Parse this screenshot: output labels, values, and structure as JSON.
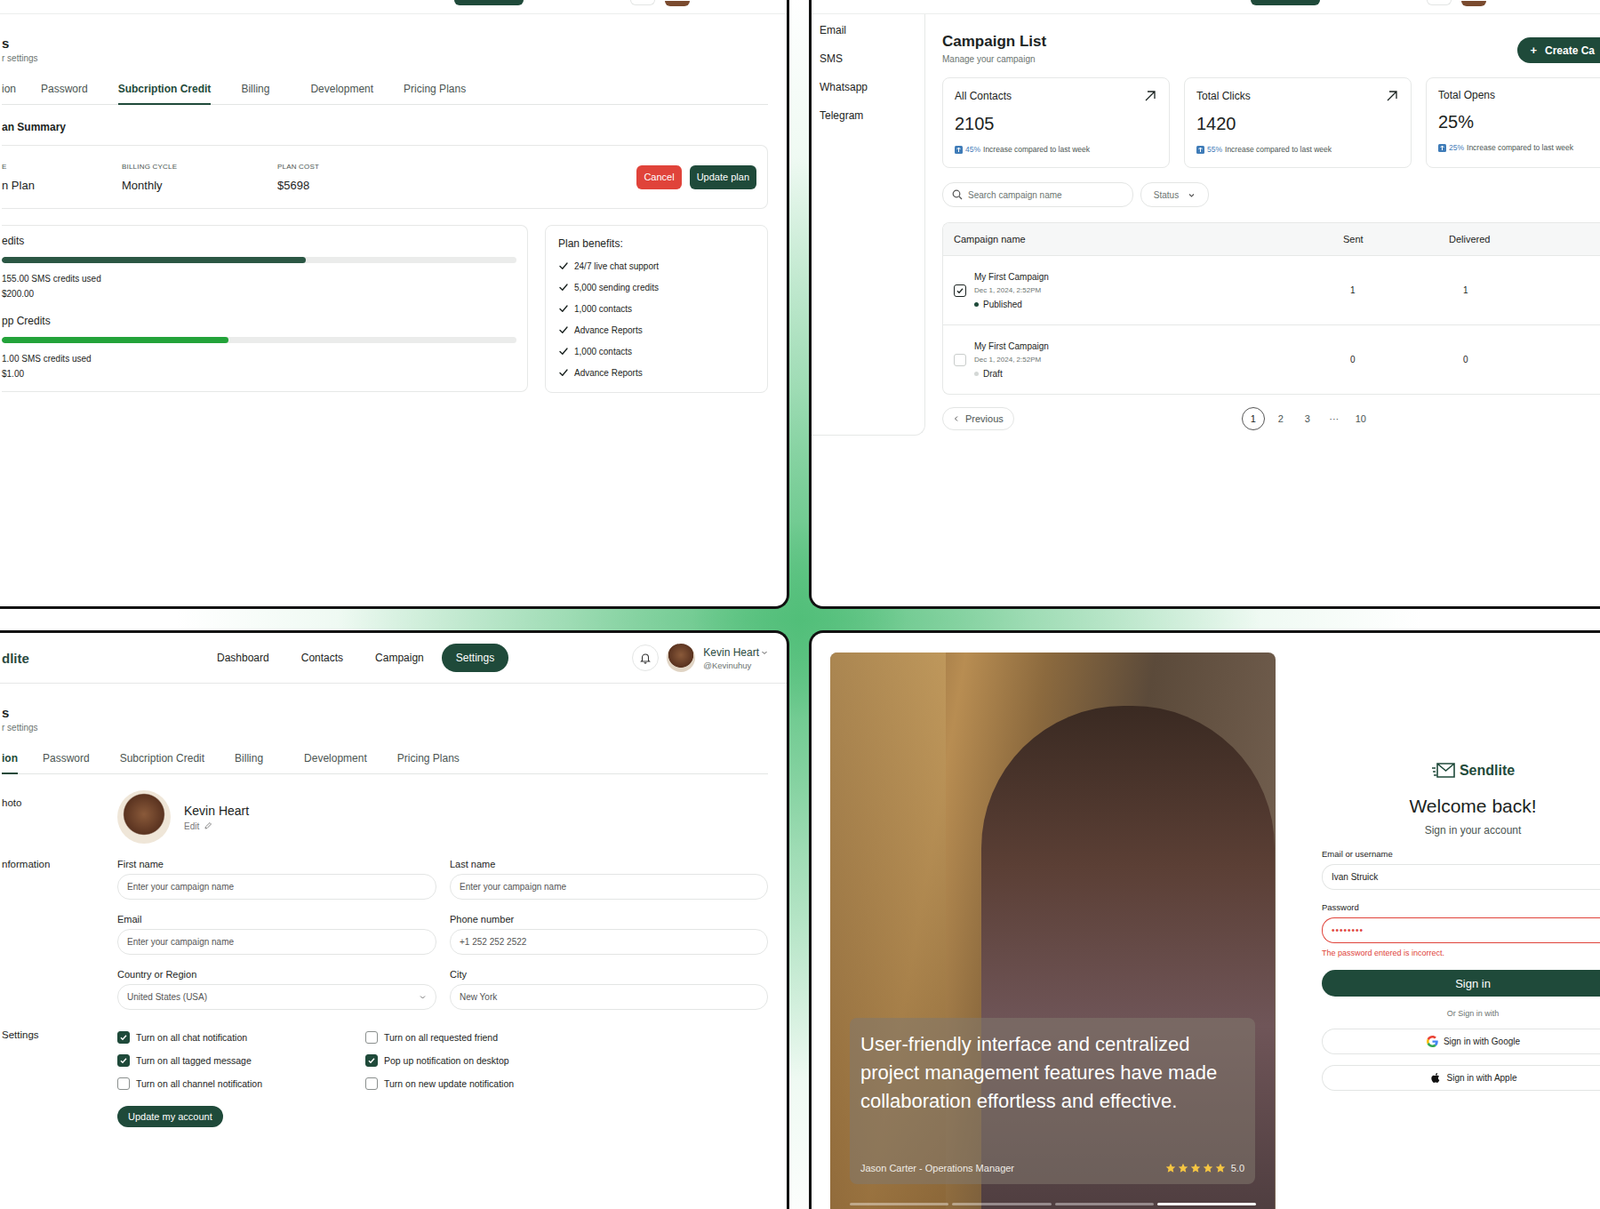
{
  "subscription_panel": {
    "page_title": "s",
    "page_subtitle": "r settings",
    "tabs": [
      {
        "label": "ion",
        "selected": false
      },
      {
        "label": "Password",
        "selected": false
      },
      {
        "label": "Subcription Credit",
        "selected": true
      },
      {
        "label": "Billing",
        "selected": false
      },
      {
        "label": "Development",
        "selected": false
      },
      {
        "label": "Pricing Plans",
        "selected": false
      }
    ],
    "plan_summary": {
      "title": "an Summary",
      "fields": [
        {
          "label": "E",
          "value": "n Plan"
        },
        {
          "label": "BILLING CYCLE",
          "value": "Monthly"
        },
        {
          "label": "PLAN COST",
          "value": "$5698"
        }
      ],
      "buttons": [
        {
          "label": "Cancel",
          "kind": "danger"
        },
        {
          "label": "Update plan",
          "kind": "primary"
        }
      ]
    },
    "credits": [
      {
        "title": "edits",
        "level": 0.59,
        "color": "#2b5744",
        "used": "155.00 SMS credits used",
        "total": "$200.00"
      },
      {
        "title": "pp Credits",
        "level": 0.44,
        "color": "#23a33a",
        "used": "1.00 SMS credits used",
        "total": "$1.00"
      }
    ],
    "benefits": {
      "title": "Plan benefits:",
      "items": [
        "24/7 live chat support",
        "5,000 sending credits",
        "1,000 contacts",
        "Advance Reports",
        "1,000 contacts",
        "Advance Reports"
      ]
    }
  },
  "campaign_panel": {
    "sidebar": [
      "Email",
      "SMS",
      "Whatsapp",
      "Telegram"
    ],
    "title": "Campaign List",
    "subtitle": "Manage your campaign",
    "create_button": {
      "icon": "+",
      "label": "Create Ca"
    },
    "stats": [
      {
        "label": "All Contacts",
        "value": "2105",
        "change": "45%",
        "note": "Increase compared to last week",
        "arrow": true
      },
      {
        "label": "Total Clicks",
        "value": "1420",
        "change": "55%",
        "note": "Increase compared to last week",
        "arrow": true
      },
      {
        "label": "Total Opens",
        "value": "25%",
        "change": "25%",
        "note": "Increase compared to last week",
        "arrow": false
      }
    ],
    "search": {
      "placeholder": "Search campaign name"
    },
    "status_filter": {
      "label": "Status"
    },
    "table": {
      "columns": [
        "Campaign name",
        "Sent",
        "Delivered"
      ],
      "rows": [
        {
          "selected": true,
          "name": "My First Campaign",
          "date": "Dec 1, 2024, 2:52PM",
          "status": "Published",
          "color": "#1f4a3a",
          "sent": "1",
          "delivered": "1"
        },
        {
          "selected": false,
          "name": "My First Campaign",
          "date": "Dec 1, 2024, 2:52PM",
          "status": "Draft",
          "color": "#d4d8d6",
          "sent": "0",
          "delivered": "0"
        }
      ]
    },
    "pagination": {
      "previous": "Previous",
      "pages": [
        {
          "label": "1",
          "selected": true
        },
        {
          "label": "2",
          "selected": false
        },
        {
          "label": "3",
          "selected": false
        },
        {
          "label": "···",
          "selected": false
        },
        {
          "label": "10",
          "selected": false
        }
      ]
    }
  },
  "profile_panel": {
    "logo": "dlite",
    "nav": [
      {
        "label": "Dashboard",
        "selected": false
      },
      {
        "label": "Contacts",
        "selected": false
      },
      {
        "label": "Campaign",
        "selected": false
      },
      {
        "label": "Settings",
        "selected": true
      }
    ],
    "user": {
      "name": "Kevin Heart",
      "handle": "@Kevinuhuy"
    },
    "page_title": "s",
    "page_subtitle": "r settings",
    "tabs": [
      {
        "label": "ion",
        "selected": true
      },
      {
        "label": "Password",
        "selected": false
      },
      {
        "label": "Subcription Credit",
        "selected": false
      },
      {
        "label": "Billing",
        "selected": false
      },
      {
        "label": "Development",
        "selected": false
      },
      {
        "label": "Pricing Plans",
        "selected": false
      }
    ],
    "sections": {
      "photo": "hoto",
      "information": "nformation",
      "settings": "Settings"
    },
    "profile": {
      "name": "Kevin Heart",
      "edit": "Edit"
    },
    "fields": [
      {
        "label": "First name",
        "text": "Enter your campaign name",
        "kind": "text"
      },
      {
        "label": "Last name",
        "text": "Enter your campaign name",
        "kind": "text"
      },
      {
        "label": "Email",
        "text": "Enter your campaign name",
        "kind": "text"
      },
      {
        "label": "Phone number",
        "text": "+1 252 252 2522",
        "kind": "text"
      },
      {
        "label": "Country or Region",
        "text": "United States (USA)",
        "kind": "select"
      },
      {
        "label": "City",
        "text": "New York",
        "kind": "text"
      }
    ],
    "notifications": [
      {
        "label": "Turn on all chat notification",
        "checked": true
      },
      {
        "label": "Turn on all requested friend",
        "checked": false
      },
      {
        "label": "Turn on all tagged message",
        "checked": true
      },
      {
        "label": "Pop up notification on desktop",
        "checked": true
      },
      {
        "label": "Turn on all channel notification",
        "checked": false
      },
      {
        "label": "Turn on new update notification",
        "checked": false
      }
    ],
    "update_button": "Update my account"
  },
  "login_panel": {
    "testimonial": {
      "quote": "User-friendly interface and centralized project management features have made collaboration effortless and effective.",
      "author": "Jason Carter - Operations Manager",
      "stars": 5,
      "rating": "5.0"
    },
    "slides": [
      {
        "selected": false
      },
      {
        "selected": false
      },
      {
        "selected": false
      },
      {
        "selected": true
      }
    ],
    "logo": "Sendlite",
    "title": "Welcome back!",
    "subtitle": "Sign in your account",
    "fields": [
      {
        "label": "Email or username",
        "value": "Ivan Struick",
        "error": false,
        "error_text": ""
      },
      {
        "label": "Password",
        "value": "••••••••",
        "error": true,
        "error_text": "The password entered is incorrect."
      }
    ],
    "submit": "Sign in",
    "divider": "Or Sign in with",
    "social": [
      {
        "label": "Sign in with Google",
        "kind": "google"
      },
      {
        "label": "Sign in with Apple",
        "kind": "apple"
      }
    ]
  }
}
